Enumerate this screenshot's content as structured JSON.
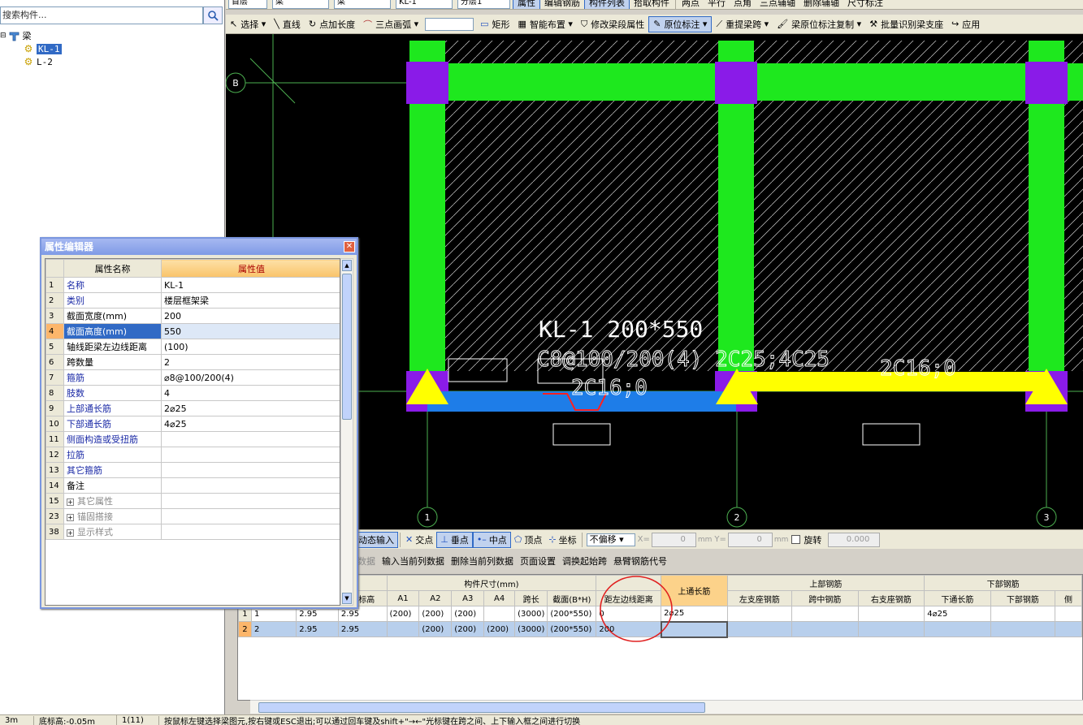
{
  "left_panel": {
    "search_placeholder": "搜索构件...",
    "tree_root": "梁",
    "tree_items": [
      "KL-1",
      "L-2"
    ]
  },
  "toolbar1": {
    "items": [
      "首层",
      "梁",
      "梁",
      "KL-1",
      "分层1",
      "属性",
      "编辑钢筋",
      "构件列表",
      "拾取构件",
      "两点",
      "平行",
      "点角",
      "三点辅轴",
      "删除辅轴",
      "尺寸标注"
    ]
  },
  "toolbar2": {
    "items": [
      "选择",
      "直线",
      "点加长度",
      "三点画弧",
      "矩形",
      "智能布置",
      "修改梁段属性",
      "原位标注",
      "重提梁跨",
      "梁原位标注复制",
      "批量识别梁支座",
      "应用"
    ]
  },
  "canvas": {
    "axis_b": "B",
    "axis_1": "1",
    "axis_2": "2",
    "axis_3": "3",
    "label_line1": "KL-1 200*550",
    "label_line2": "C8@100/200(4) 2C25;4C25",
    "label_line3": "2C16;0",
    "label_line4": "2C16;0"
  },
  "snap_bar": {
    "dynamic_input": "动态输入",
    "items": [
      "交点",
      "垂点",
      "中点",
      "顶点",
      "坐标"
    ],
    "offset_mode": "不偏移",
    "x_label": "X=",
    "x_value": "0",
    "y_label": "Y=",
    "y_value": "0",
    "unit": "mm",
    "rotate_label": "旋转",
    "rotate_value": "0.000"
  },
  "table_menu": {
    "items": [
      "数据",
      "输入当前列数据",
      "删除当前列数据",
      "页面设置",
      "调换起始跨",
      "悬臂钢筋代号"
    ]
  },
  "grid": {
    "group_size": "构件尺寸(mm)",
    "group_top": "上部钢筋",
    "group_bottom": "下部钢筋",
    "headers": [
      "点标高",
      "A1",
      "A2",
      "A3",
      "A4",
      "跨长",
      "截面(B*H)",
      "距左边线距离",
      "上通长筋",
      "左支座钢筋",
      "跨中钢筋",
      "右支座钢筋",
      "下通长筋",
      "下部钢筋",
      "侧"
    ],
    "rows": [
      {
        "rn": "1",
        "span": "1",
        "h1": "2.95",
        "h2": "2.95",
        "a1": "(200)",
        "a2": "(200)",
        "a3": "(200)",
        "a4": "",
        "len": "(3000)",
        "sec": "(200*550)",
        "dist": "0",
        "top": "2⌀25",
        "left": "",
        "mid": "",
        "right": "",
        "bot": "4⌀25"
      },
      {
        "rn": "2",
        "span": "2",
        "h1": "2.95",
        "h2": "2.95",
        "a1": "",
        "a2": "(200)",
        "a3": "(200)",
        "a4": "(200)",
        "len": "(3000)",
        "sec": "(200*550)",
        "dist": "200",
        "top": "",
        "left": "",
        "mid": "",
        "right": "",
        "bot": ""
      }
    ]
  },
  "status_bar": {
    "cells": [
      "3m",
      "底标高:-0.05m",
      "1(11)",
      "按鼠标左键选择梁图元,按右键或ESC退出;可以通过回车键及shift+\"→←\"光标键在跨之间、上下输入框之间进行切换"
    ]
  },
  "prop_dialog": {
    "title": "属性编辑器",
    "col_name": "属性名称",
    "col_value": "属性值",
    "rows": [
      {
        "n": "1",
        "name": "名称",
        "value": "KL-1"
      },
      {
        "n": "2",
        "name": "类别",
        "value": "楼层框架梁"
      },
      {
        "n": "3",
        "name": "截面宽度(mm)",
        "value": "200"
      },
      {
        "n": "4",
        "name": "截面高度(mm)",
        "value": "550"
      },
      {
        "n": "5",
        "name": "轴线距梁左边线距离",
        "value": "(100)"
      },
      {
        "n": "6",
        "name": "跨数量",
        "value": "2"
      },
      {
        "n": "7",
        "name": "箍筋",
        "value": "⌀8@100/200(4)"
      },
      {
        "n": "8",
        "name": "肢数",
        "value": "4"
      },
      {
        "n": "9",
        "name": "上部通长筋",
        "value": "2⌀25"
      },
      {
        "n": "10",
        "name": "下部通长筋",
        "value": "4⌀25"
      },
      {
        "n": "11",
        "name": "侧面构造或受扭筋",
        "value": ""
      },
      {
        "n": "12",
        "name": "拉筋",
        "value": ""
      },
      {
        "n": "13",
        "name": "其它箍筋",
        "value": ""
      },
      {
        "n": "14",
        "name": "备注",
        "value": ""
      },
      {
        "n": "15",
        "name": "其它属性",
        "value": ""
      },
      {
        "n": "23",
        "name": "锚固搭接",
        "value": ""
      },
      {
        "n": "38",
        "name": "显示样式",
        "value": ""
      }
    ]
  }
}
